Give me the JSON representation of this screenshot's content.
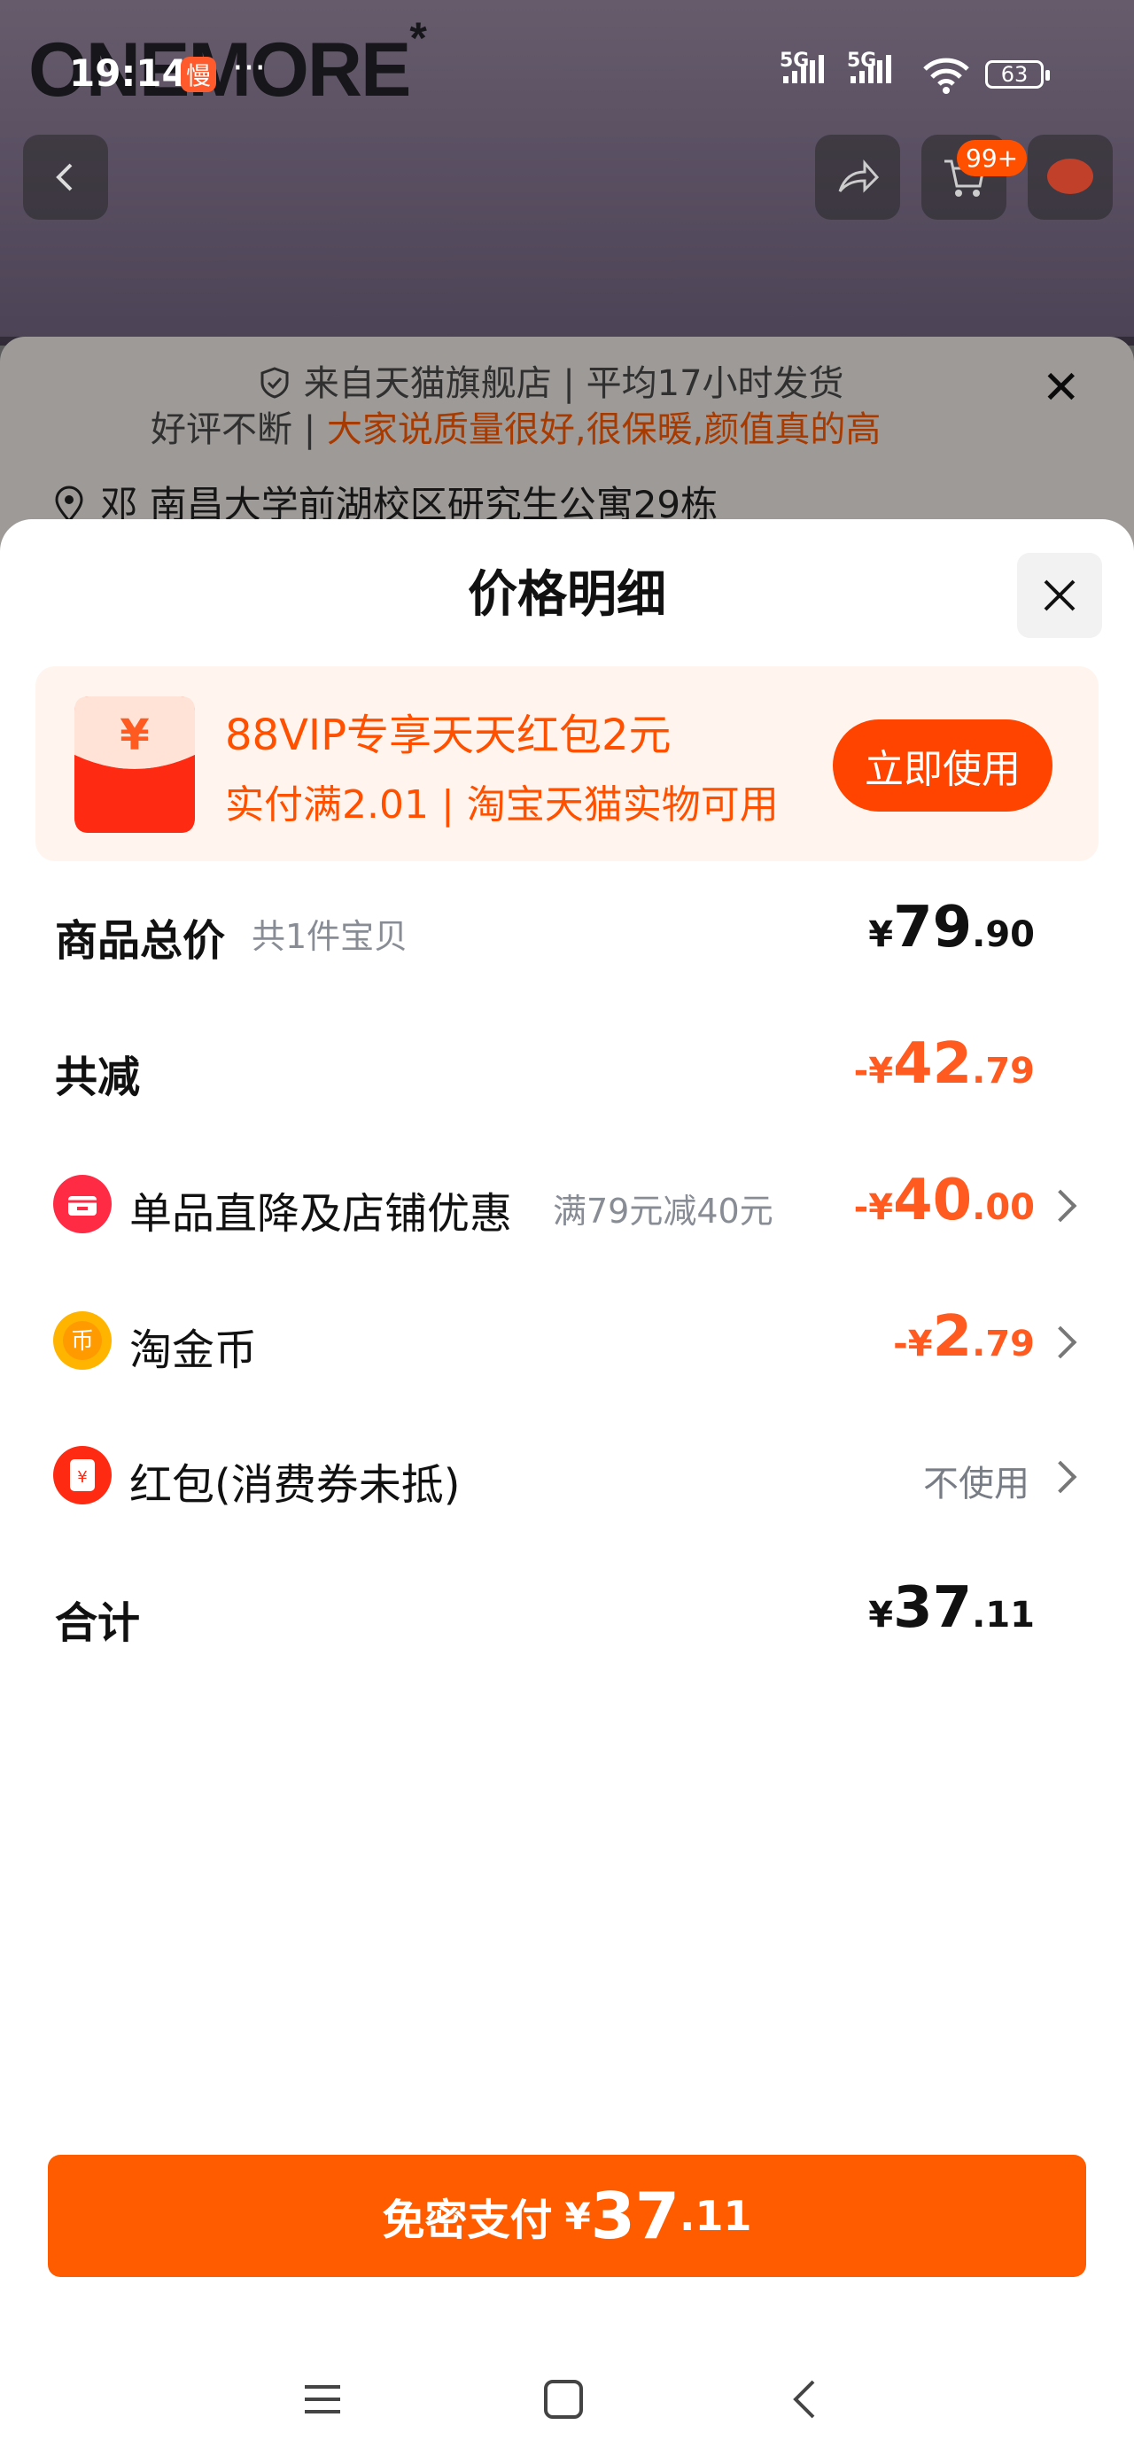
{
  "status_bar": {
    "time": "19:14",
    "app_badge": "慢",
    "more": "···",
    "signal1_label": "5G",
    "signal2_label": "5G",
    "battery": "63"
  },
  "background": {
    "brand": "ONEMORE",
    "brand_mark": "*",
    "cart_badge": "99+",
    "shop_line": "来自天猫旗舰店 | 平均17小时发货",
    "review_line_prefix": "好评不断 | ",
    "review_line": "大家说质量很好,很保暖,颜值真的高",
    "address": "邓  南昌大学前湖校区研究生公寓29栋"
  },
  "sheet": {
    "title": "价格明细",
    "close_icon": "close-icon"
  },
  "promo": {
    "title": "88VIP专享天天红包2元",
    "subtitle": "实付满2.01 | 淘宝天猫实物可用",
    "button": "立即使用",
    "icon_symbol": "¥"
  },
  "rows": {
    "total": {
      "label": "商品总价",
      "note": "共1件宝贝",
      "currency": "¥",
      "int": "79",
      "dec": ".90"
    },
    "reduce": {
      "label": "共减",
      "currency": "-¥",
      "int": "42",
      "dec": ".79"
    },
    "store": {
      "label": "单品直降及店铺优惠",
      "note": "满79元减40元",
      "currency": "-¥",
      "int": "40",
      "dec": ".00"
    },
    "coin": {
      "label": "淘金币",
      "icon_glyph": "币",
      "currency": "-¥",
      "int": "2",
      "dec": ".79"
    },
    "redpacket": {
      "label": "红包(消费券未抵)",
      "icon_glyph": "¥",
      "value": "不使用"
    },
    "sum": {
      "label": "合计",
      "currency": "¥",
      "int": "37",
      "dec": ".11"
    }
  },
  "pay": {
    "label": "免密支付",
    "currency": "¥",
    "int": "37",
    "dec": ".11"
  },
  "colors": {
    "accent": "#ff5c00",
    "price_orange": "#ff5a1f"
  }
}
